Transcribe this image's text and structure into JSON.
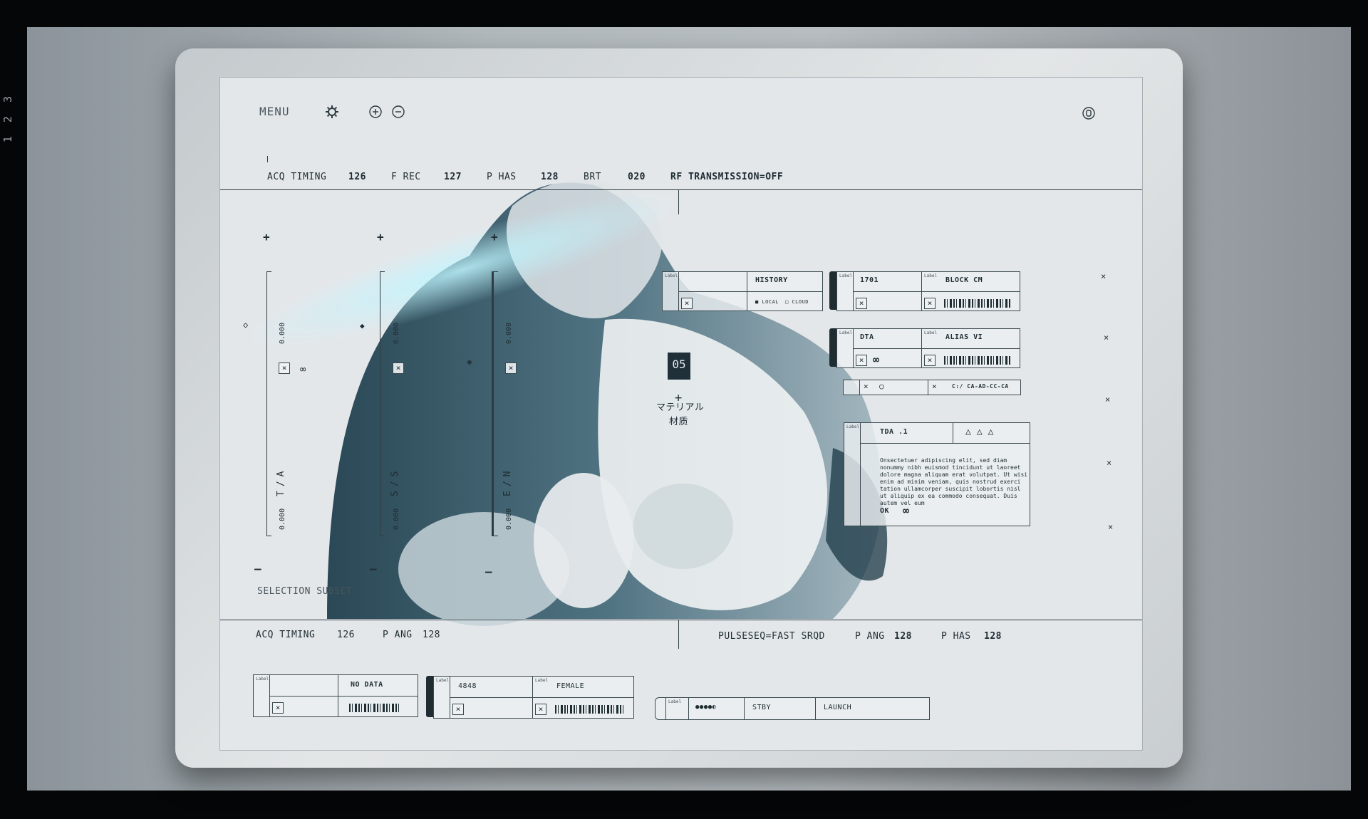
{
  "frame": {
    "counter": "1 2 3"
  },
  "toolbar": {
    "menu_label": "MENU",
    "icons": {
      "settings": "gear-icon",
      "zoom_in": "plus-circle-icon",
      "zoom_out": "minus-circle-icon",
      "power": "power-icon"
    }
  },
  "status_top": {
    "acq_label": "ACQ TIMING",
    "acq_value": "126",
    "frec_label": "F REC",
    "frec_value": "127",
    "phas_label": "P HAS",
    "phas_value": "128",
    "brt_label": "BRT",
    "brt_value": "020",
    "rf_label": "RF TRANSMISSION=OFF"
  },
  "sliders": [
    {
      "value_top": "0.000",
      "code": "T/A",
      "value_bottom": "0.000"
    },
    {
      "value_top": "0.000",
      "code": "S/S",
      "value_bottom": "0.000"
    },
    {
      "value_top": "0.000",
      "code": "E/N",
      "value_bottom": "0.000"
    }
  ],
  "center": {
    "badge": "05",
    "jp_line1": "マテリアル",
    "jp_line2": "材质"
  },
  "panels": {
    "history": {
      "small_label": "Label",
      "title": "HISTORY",
      "opt_local": "LOCAL",
      "opt_cloud": "CLOUD"
    },
    "block": {
      "small_label_a": "Label",
      "value_a": "1701",
      "small_label_b": "Label",
      "value_b": "BLOCK CM"
    },
    "dta": {
      "small_label_a": "Label",
      "value_a": "DTA",
      "small_label_b": "Label",
      "value_b": "ALIAS VI"
    },
    "path": {
      "value": "C:/ CA-AD-CC-CA"
    },
    "tda": {
      "small_label": "Label",
      "title": "TDA .1",
      "body": "Onsectetuer adipiscing elit, sed diam nonummy nibh euismod tincidunt ut laoreet dolore magna aliquam erat volutpat. Ut wisi enim ad minim veniam, quis nostrud exerci tation ullamcorper suscipit lobortis nisl ut aliquip ex ea commodo consequat. Duis autem vel eum",
      "ok_label": "OK"
    }
  },
  "selection_label": "SELECTION SUBSET",
  "status_bottom_left": {
    "acq_label": "ACQ TIMING",
    "acq_value": "126",
    "pang_label": "P ANG",
    "pang_value": "128"
  },
  "status_bottom_right": {
    "pulse_label": "PULSESEQ=FAST SRQD",
    "pang_label": "P ANG",
    "pang_value": "128",
    "phas_label": "P HAS",
    "phas_value": "128"
  },
  "bottom_panels": {
    "nodata": {
      "small_label": "Label",
      "value": "NO DATA"
    },
    "patient": {
      "small_label_a": "Label",
      "value_a": "4848",
      "small_label_b": "Label",
      "value_b": "FEMALE"
    },
    "launch": {
      "small_label": "Label",
      "indicator": "●●●●◐",
      "stby_label": "STBY",
      "launch_label": "LAUNCH"
    }
  }
}
